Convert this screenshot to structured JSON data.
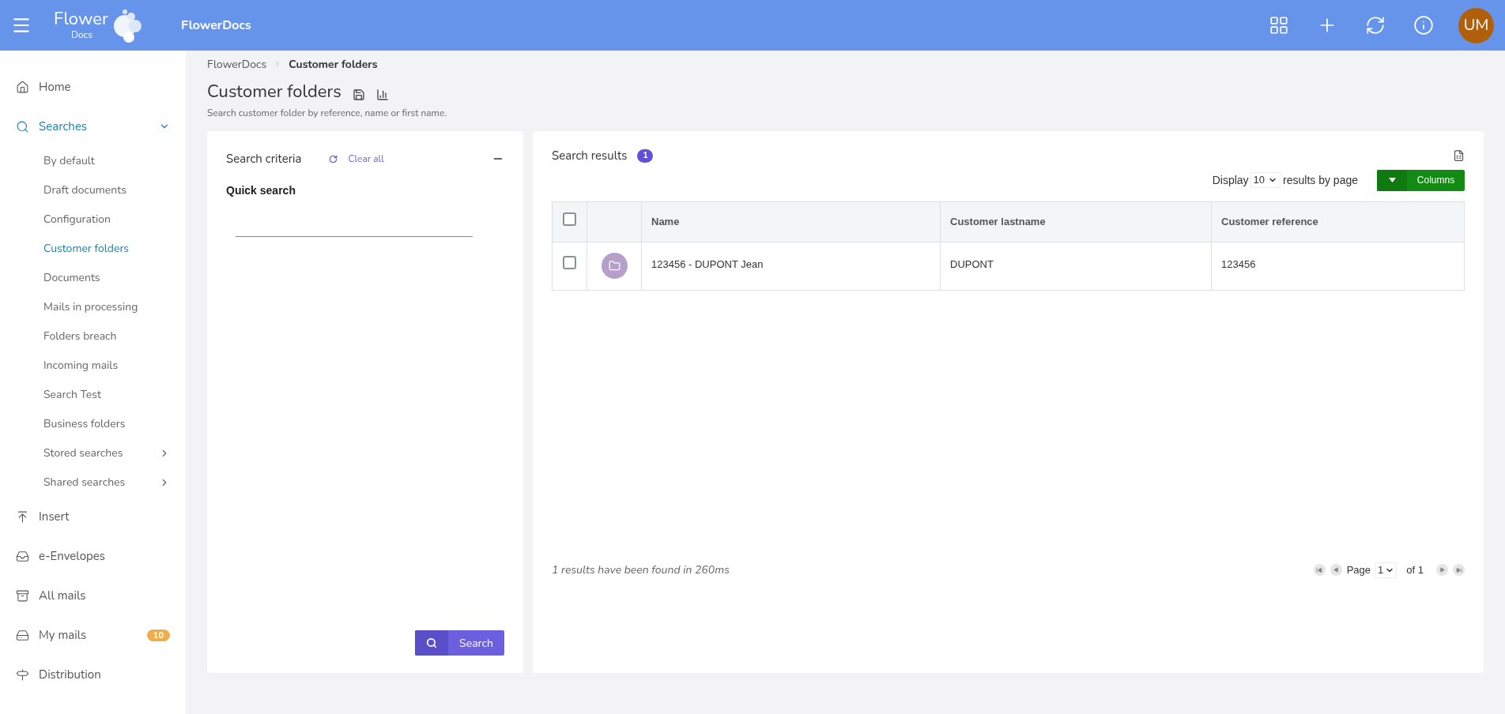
{
  "header": {
    "logo_top": "Flower",
    "logo_bottom": "Docs",
    "app_name": "FlowerDocs",
    "actions": [
      {
        "kind": "grid"
      },
      {
        "kind": "add"
      },
      {
        "kind": "refresh"
      },
      {
        "kind": "info"
      }
    ],
    "avatar": "UM"
  },
  "sidebar": {
    "items": [
      {
        "kind": "home",
        "label": "Home",
        "selected": false
      },
      {
        "kind": "search",
        "label": "Searches",
        "selected": true,
        "expanded": true,
        "children": [
          {
            "label": "By default",
            "selected": false
          },
          {
            "label": "Draft documents",
            "selected": false
          },
          {
            "label": "Configuration",
            "selected": false
          },
          {
            "label": "Customer folders",
            "selected": true
          },
          {
            "label": "Documents",
            "selected": false
          },
          {
            "label": "Mails in processing",
            "selected": false
          },
          {
            "label": "Folders breach",
            "selected": false
          },
          {
            "label": "Incoming mails",
            "selected": false
          },
          {
            "label": "Search Test",
            "selected": false
          },
          {
            "label": "Business folders",
            "selected": false
          },
          {
            "label": "Stored searches",
            "selected": false,
            "expanded": false
          },
          {
            "label": "Shared searches",
            "selected": false,
            "expanded": false
          }
        ]
      },
      {
        "kind": "insert",
        "label": "Insert",
        "selected": false
      },
      {
        "kind": "envelope",
        "label": "e-Envelopes",
        "selected": false
      },
      {
        "kind": "archive",
        "label": "All mails",
        "selected": false
      },
      {
        "kind": "drive",
        "label": "My mails",
        "selected": false,
        "badge": "10"
      },
      {
        "kind": "signpost",
        "label": "Distribution",
        "selected": false
      }
    ]
  },
  "breadcrumb": [
    "FlowerDocs",
    "Customer folders"
  ],
  "page": {
    "title": "Customer folders",
    "subtitle": "Search customer folder by reference, name or first name."
  },
  "criteria": {
    "title": "Search criteria",
    "clear": "Clear all",
    "quick_label": "Quick search",
    "button": "Search"
  },
  "results": {
    "title": "Search results",
    "count": "1",
    "display": "Display",
    "page_size": "10",
    "per_page": "results by page",
    "columns_button": "Columns",
    "table": {
      "header_checked": false,
      "columns": [
        "Name",
        "Customer lastname",
        "Customer reference"
      ],
      "rows": [
        {
          "checked": false,
          "cells": [
            "123456 - DUPONT Jean",
            "DUPONT",
            "123456"
          ]
        }
      ]
    },
    "summary": "1 results have been found in 260ms",
    "pagination": {
      "label": "Page",
      "page": "1",
      "of": "of 1"
    }
  }
}
